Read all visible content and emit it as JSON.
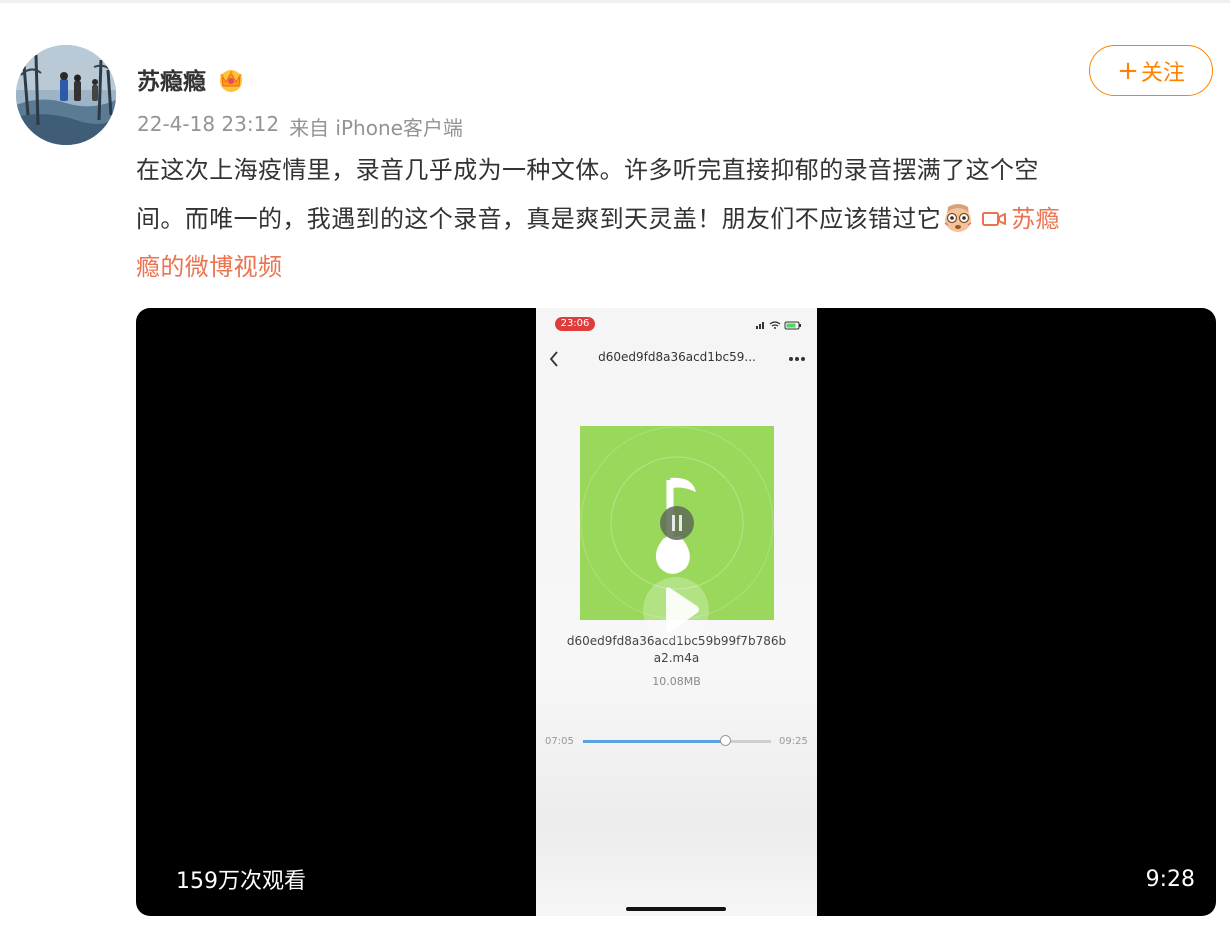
{
  "post": {
    "username": "苏瘾瘾",
    "timestamp": "22-4-18 23:12",
    "source": "来自 iPhone客户端",
    "follow_label": "关注",
    "text_lines": [
      "在这次上海疫情里，录音几乎成为一种文体。许多听完直接抑郁的录音摆满了这个空",
      "间。而唯一的，我遇到的这个录音，真是爽到天灵盖！朋友们不应该错过它"
    ],
    "video_link_part1": "苏瘾",
    "video_link_part2": "瘾的微博视频",
    "emoji_icon": "awkward-face-emoji-icon",
    "accent_color": "#ff8200",
    "link_color": "#eb7350"
  },
  "video": {
    "view_count": "159万次观看",
    "duration": "9:28",
    "phone": {
      "status_time": "23:06",
      "file_title": "d60ed9fd8a36acd1bc59...",
      "file_name": "d60ed9fd8a36acd1bc59b99f7b786ba2.m4a",
      "file_size": "10.08MB",
      "elapsed": "07:05",
      "total": "09:25",
      "progress_fraction": 0.755,
      "cover_color": "#9ad85c"
    }
  }
}
